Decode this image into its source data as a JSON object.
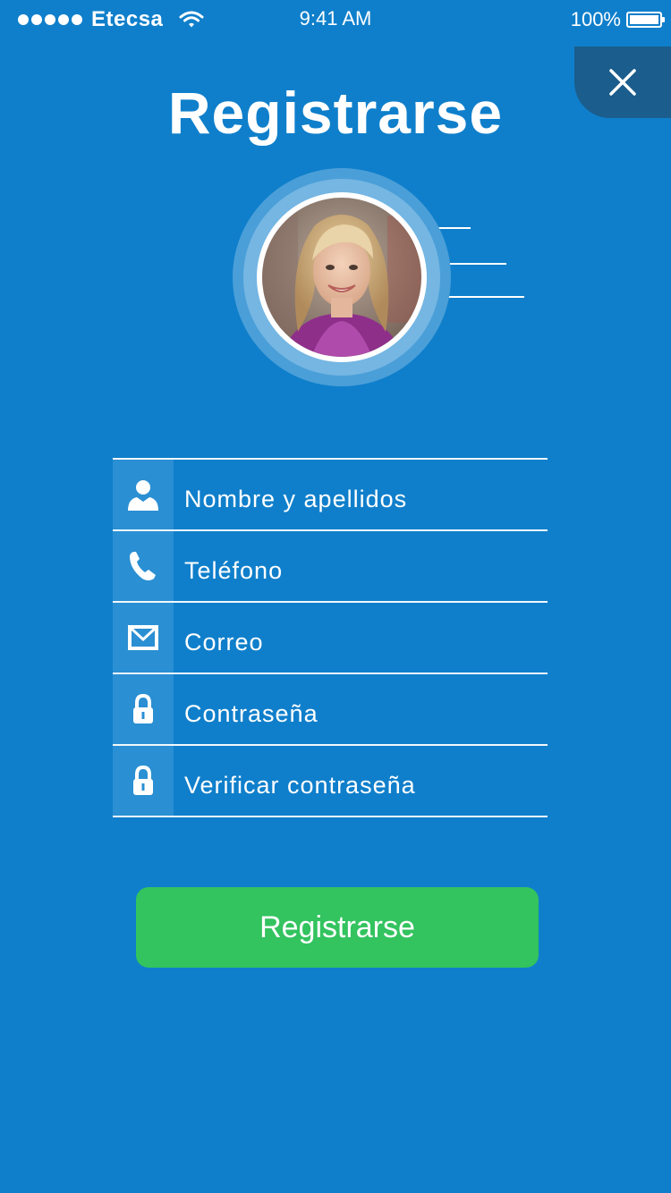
{
  "status_bar": {
    "carrier": "Etecsa",
    "time": "9:41 AM",
    "battery": "100%"
  },
  "header": {
    "title": "Registrarse",
    "close_icon": "close-icon"
  },
  "avatar": {
    "icon": "profile-photo"
  },
  "form": {
    "fields": [
      {
        "icon": "user-icon",
        "placeholder": "Nombre y apellidos"
      },
      {
        "icon": "phone-icon",
        "placeholder": "Teléfono"
      },
      {
        "icon": "mail-icon",
        "placeholder": "Correo"
      },
      {
        "icon": "lock-icon",
        "placeholder": "Contraseña"
      },
      {
        "icon": "lock-icon",
        "placeholder": "Verificar contraseña"
      }
    ]
  },
  "actions": {
    "register_label": "Registrarse"
  },
  "colors": {
    "background": "#0f7fcb",
    "close_tab": "#1b5d8c",
    "icon_box": "#2a8fd3",
    "button": "#33c35f"
  }
}
